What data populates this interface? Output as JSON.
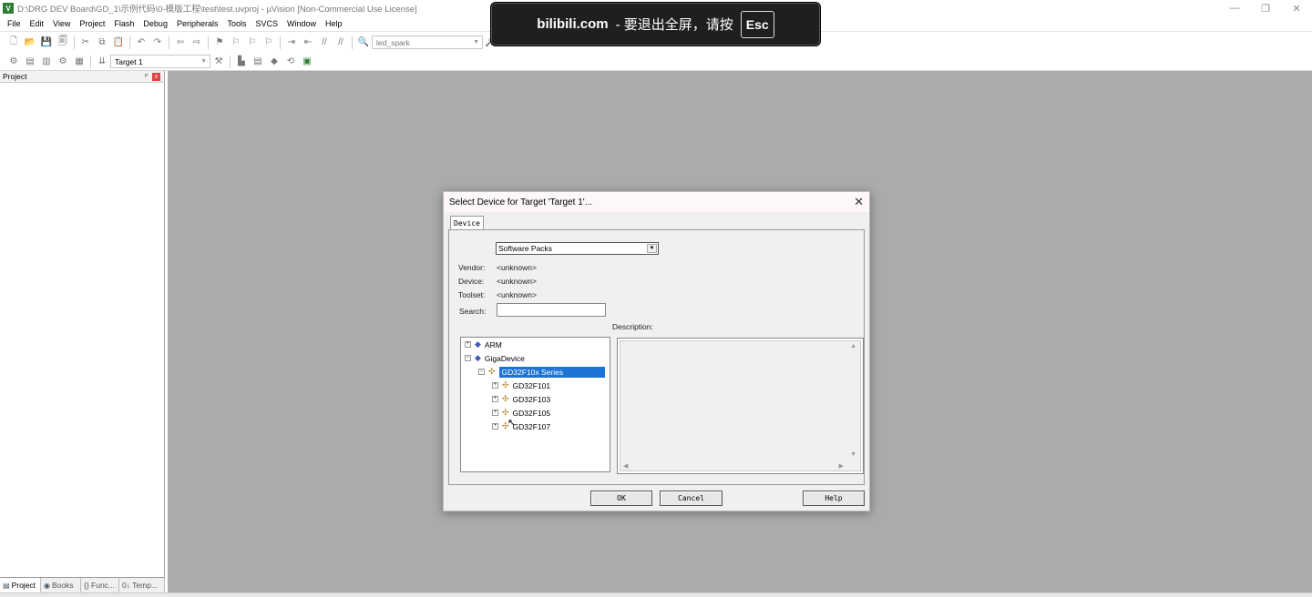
{
  "window": {
    "title": "D:\\DRG DEV Board\\GD_1\\示例代码\\0-模版工程\\test\\test.uvproj - µVision  [Non-Commercial Use License]",
    "app_icon": "V",
    "controls": [
      "—",
      "❐",
      "✕"
    ]
  },
  "menu": [
    "File",
    "Edit",
    "View",
    "Project",
    "Flash",
    "Debug",
    "Peripherals",
    "Tools",
    "SVCS",
    "Window",
    "Help"
  ],
  "toolbar": {
    "find_combo": "led_spark",
    "target_combo": "Target 1"
  },
  "banner": {
    "site": "bilibili.com",
    "message": "-  要退出全屏，请按",
    "key": "Esc"
  },
  "project_pane": {
    "title": "Project",
    "pin": "ᵖ",
    "close": "x",
    "tabs": [
      {
        "label": "Project",
        "icon": "project-icon"
      },
      {
        "label": "Books",
        "icon": "books-icon"
      },
      {
        "label": "{} Func...",
        "icon": "functions-icon"
      },
      {
        "label": "0↓ Temp...",
        "icon": "templates-icon"
      }
    ]
  },
  "dialog": {
    "title": "Select Device for Target 'Target 1'...",
    "tab": "Device",
    "source_select": "Software Packs",
    "vendor_label": "Vendor:",
    "vendor_value": "<unknown>",
    "device_label": "Device:",
    "device_value": "<unknown>",
    "toolset_label": "Toolset:",
    "toolset_value": "<unknown>",
    "search_label": "Search:",
    "search_value": "",
    "description_label": "Description:",
    "tree": {
      "arm": "ARM",
      "gigadevice": "GigaDevice",
      "series": "GD32F10x Series",
      "devices": [
        "GD32F101",
        "GD32F103",
        "GD32F105",
        "GD32F107"
      ]
    },
    "buttons": {
      "ok": "OK",
      "cancel": "Cancel",
      "help": "Help"
    }
  },
  "colors": {
    "workspace": "#ababab",
    "selection": "#1e73d6",
    "banner_bg": "#1f1f21"
  }
}
